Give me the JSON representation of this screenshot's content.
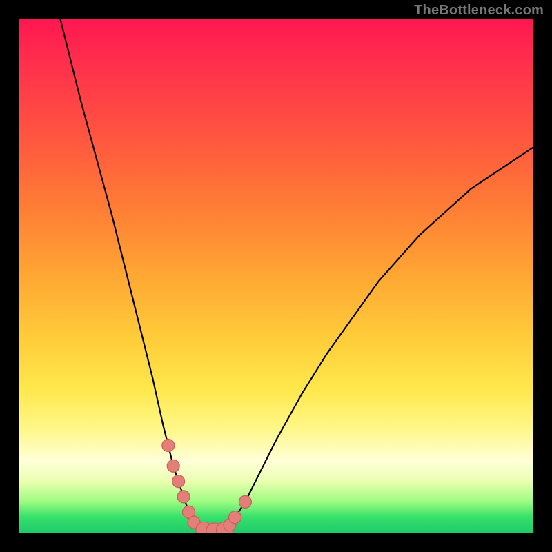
{
  "watermark": "TheBottleneck.com",
  "colors": {
    "dot_fill": "#e37e78",
    "dot_stroke": "#c95f58",
    "curve": "#000000"
  },
  "chart_data": {
    "type": "line",
    "title": "",
    "xlabel": "",
    "ylabel": "",
    "xlim": [
      0,
      100
    ],
    "ylim": [
      0,
      100
    ],
    "grid": false,
    "description": "Bottleneck-style V-curve on a vertical green(bottom)→red(top) heat gradient. The curve descends steeply from top-left, reaches a flat minimum near x≈33–40 at y≈0, then rises more gradually toward the top-right. Salmon dots mark the points nearest the minimum on both sides and along the flat bottom.",
    "series": [
      {
        "name": "curve",
        "x": [
          8,
          10,
          12,
          15,
          18,
          20,
          22,
          24,
          26,
          28,
          29,
          30,
          31,
          32,
          33,
          34,
          36,
          38,
          40,
          41,
          42,
          44,
          46,
          50,
          55,
          60,
          65,
          70,
          78,
          88,
          100
        ],
        "y": [
          100,
          92,
          84,
          73,
          62,
          54,
          46,
          38,
          30,
          21,
          17,
          13,
          10,
          7,
          4,
          2,
          0.5,
          0.3,
          0.5,
          1.5,
          3,
          6,
          10,
          18,
          27,
          35,
          42,
          49,
          58,
          67,
          75
        ]
      }
    ],
    "highlight_points": {
      "name": "near-optimal-dots",
      "x": [
        29,
        30,
        31,
        32,
        33,
        34,
        36,
        38,
        40,
        41,
        42,
        44
      ],
      "y": [
        17,
        13,
        10,
        7,
        4,
        2,
        0.5,
        0.3,
        0.5,
        1.5,
        3,
        6
      ]
    }
  }
}
